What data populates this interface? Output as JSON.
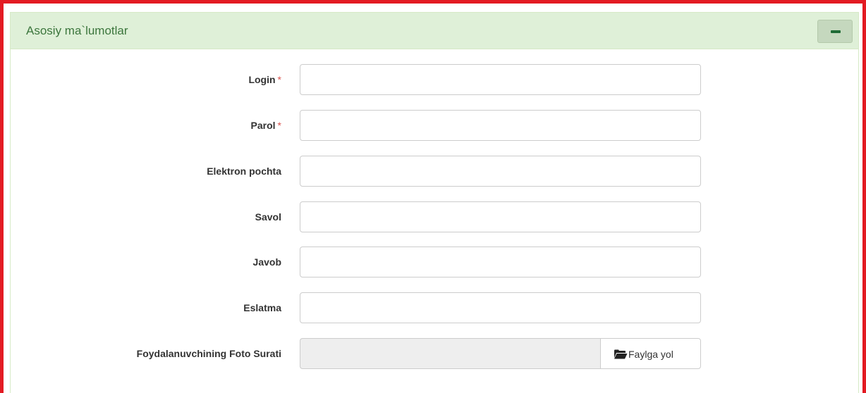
{
  "panel": {
    "title": "Asosiy ma`lumotlar",
    "collapse_icon": "minus-icon",
    "accent_color": "#dff0d8",
    "frame_color": "#e31b23"
  },
  "form": {
    "required_marker": "*",
    "fields": [
      {
        "label": "Login",
        "required": true,
        "value": "",
        "placeholder": ""
      },
      {
        "label": "Parol",
        "required": true,
        "value": "",
        "placeholder": ""
      },
      {
        "label": "Elektron pochta",
        "required": false,
        "value": "",
        "placeholder": ""
      },
      {
        "label": "Savol",
        "required": false,
        "value": "",
        "placeholder": ""
      },
      {
        "label": "Javob",
        "required": false,
        "value": "",
        "placeholder": ""
      },
      {
        "label": "Eslatma",
        "required": false,
        "value": "",
        "placeholder": ""
      }
    ],
    "photo": {
      "label": "Foydalanuvchining Foto Surati",
      "button_label": "Faylga yol",
      "button_icon": "folder-open-icon"
    }
  }
}
